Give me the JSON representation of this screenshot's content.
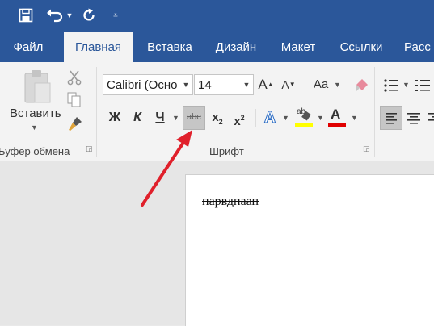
{
  "colors": {
    "brand": "#2b579a",
    "ribbon": "#f3f3f3",
    "arrow": "#e0202b",
    "highlight": "#ffff00",
    "font_color": "#e00000"
  },
  "quick_access": {
    "save_icon": "save-icon",
    "undo_icon": "undo-icon",
    "redo_icon": "repeat-icon",
    "customize_icon": "customize-icon"
  },
  "tabs": [
    {
      "label": "Файл",
      "active": false
    },
    {
      "label": "Главная",
      "active": true
    },
    {
      "label": "Вставка",
      "active": false
    },
    {
      "label": "Дизайн",
      "active": false
    },
    {
      "label": "Макет",
      "active": false
    },
    {
      "label": "Ссылки",
      "active": false
    },
    {
      "label": "Расс",
      "active": false
    }
  ],
  "clipboard": {
    "paste_label": "Вставить",
    "group_label": "Буфер обмена"
  },
  "font": {
    "font_name": "Calibri (Осно",
    "font_size": "14",
    "bold": "Ж",
    "italic": "К",
    "underline": "Ч",
    "strikethrough": "abc",
    "subscript_base": "x",
    "subscript_mark": "2",
    "superscript_base": "x",
    "superscript_mark": "2",
    "text_effects": "A",
    "highlight_letters": "ab",
    "font_color_letter": "A",
    "grow_font": "A",
    "shrink_font": "A",
    "change_case": "Aa",
    "group_label": "Шрифт"
  },
  "document": {
    "text": "парвдпаап"
  }
}
